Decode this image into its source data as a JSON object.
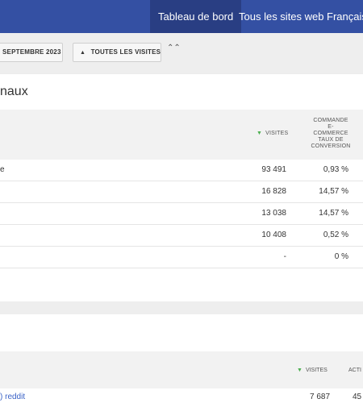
{
  "nav": {
    "items": [
      {
        "label": "Tableau de bord",
        "active": true
      },
      {
        "label": "Tous les sites web",
        "active": false
      },
      {
        "label": "Français",
        "active": false
      }
    ]
  },
  "toolbar": {
    "date_label": "SEPTEMBRE 2023",
    "segment_label": "TOUTES LES VISITES",
    "segment_icon": "users-icon",
    "collapse_icon": "chevrons-up-icon"
  },
  "channels_card": {
    "title": "naux",
    "columns": {
      "visits": "VISITES",
      "conversion": [
        "COMMANDE",
        "E-",
        "COMMERCE",
        "TAUX DE",
        "CONVERSION"
      ]
    },
    "rows": [
      {
        "label": "e",
        "visits": "93 491",
        "conversion": "0,93 %"
      },
      {
        "label": "",
        "visits": "16 828",
        "conversion": "14,57 %"
      },
      {
        "label": "",
        "visits": "13 038",
        "conversion": "14,57 %"
      },
      {
        "label": "",
        "visits": "10 408",
        "conversion": "0,52 %"
      },
      {
        "label": "",
        "visits": "-",
        "conversion": "0 %"
      }
    ]
  },
  "second_card": {
    "columns": {
      "visits": "VISITES",
      "actions": "ACTI"
    },
    "rows": [
      {
        "label": ") reddit",
        "visits": "7 687",
        "actions": "45"
      }
    ]
  },
  "colors": {
    "nav_bg": "#3450a3",
    "nav_active": "#293e83",
    "sort_arrow": "#4caf50",
    "link": "#3b63c7"
  }
}
